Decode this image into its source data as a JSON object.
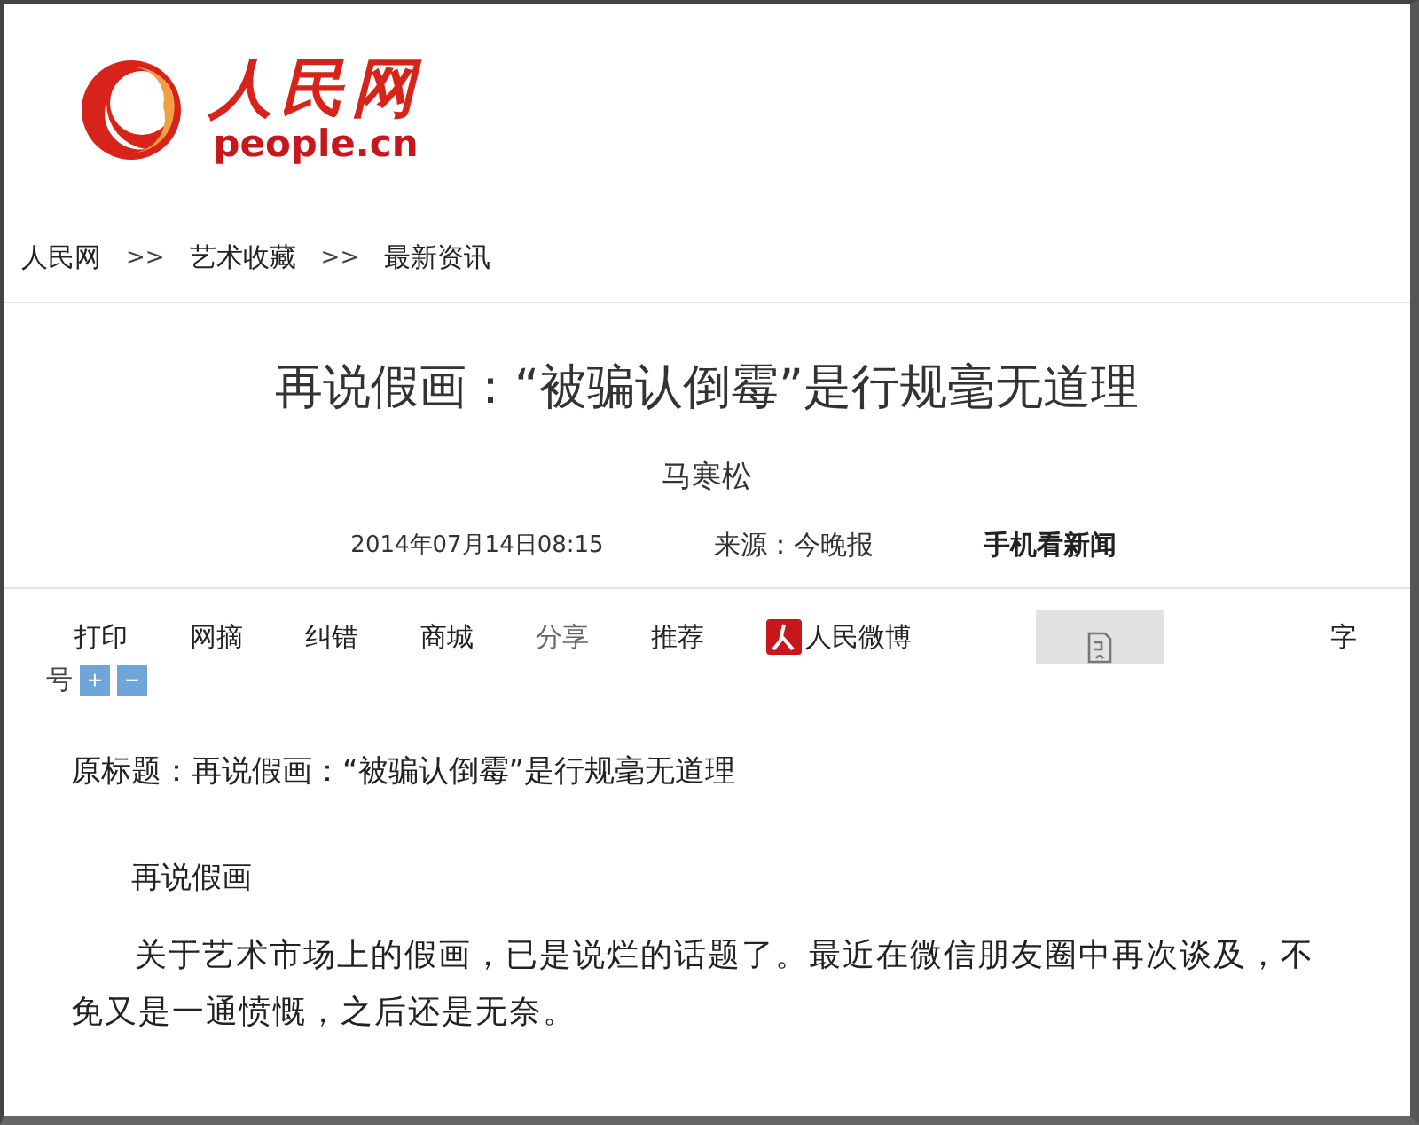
{
  "logo": {
    "name": "人民网",
    "domain": "people.cn"
  },
  "breadcrumb": {
    "items": [
      "人民网",
      "艺术收藏",
      "最新资讯"
    ],
    "separator": ">>"
  },
  "article": {
    "title": "再说假画：“被骗认倒霉”是行规毫无道理",
    "author": "马寒松",
    "date": "2014年07月14日08:15",
    "source": "来源：今晚报",
    "mobile_link": "手机看新闻"
  },
  "toolbar": {
    "items": [
      {
        "label": "打印",
        "kind": "link"
      },
      {
        "label": "网摘",
        "kind": "link"
      },
      {
        "label": "纠错",
        "kind": "link"
      },
      {
        "label": "商城",
        "kind": "link"
      },
      {
        "label": "分享",
        "kind": "muted"
      },
      {
        "label": "推荐",
        "kind": "link"
      },
      {
        "label": "人民微博",
        "kind": "weibo"
      },
      {
        "kind": "image"
      }
    ],
    "font_size_label_1": "字",
    "font_size_label_2": "号",
    "increase": "+",
    "decrease": "−"
  },
  "body": [
    "原标题：再说假画：“被骗认倒霉”是行规毫无道理",
    "再说假画",
    "关于艺术市场上的假画，已是说烂的话题了。最近在微信朋友圈中再次谈及，不免又是一通愤慨，之后还是无奈。"
  ]
}
